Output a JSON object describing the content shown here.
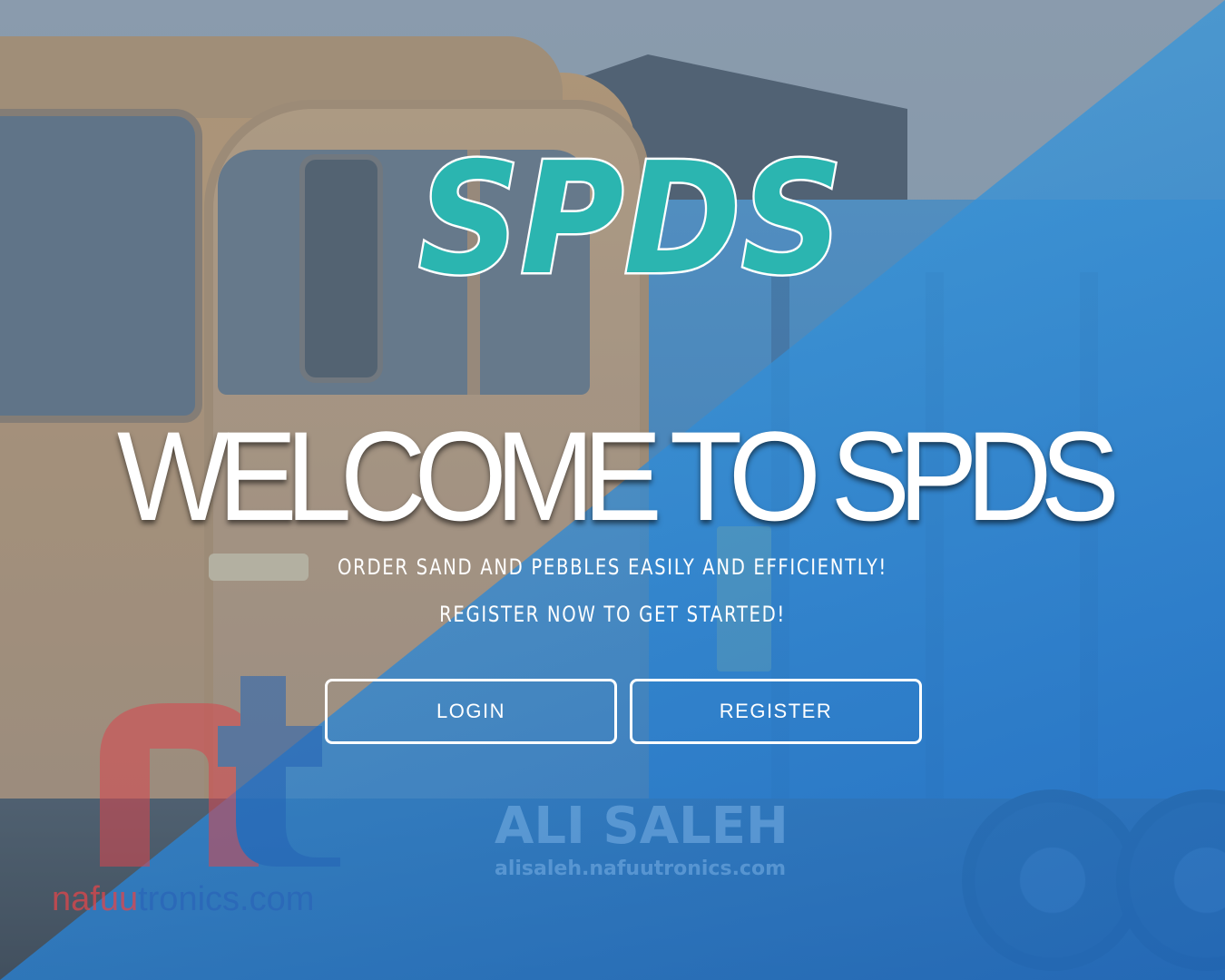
{
  "logo": {
    "text": "SPDS"
  },
  "hero": {
    "headline": "WELCOME TO SPDS",
    "tagline_1": "ORDER SAND AND PEBBLES EASILY AND EFFICIENTLY!",
    "tagline_2": "REGISTER NOW TO GET STARTED!"
  },
  "actions": {
    "login_label": "LOGIN",
    "register_label": "REGISTER"
  },
  "watermarks": {
    "brand_mark": "nt",
    "brand_domain_part1": "nafuu",
    "brand_domain_part2": "tronics.com",
    "author_name": "ALI SALEH",
    "author_url": "alisaleh.nafuutronics.com"
  },
  "colors": {
    "logo_fill": "#2bb5b0",
    "overlay_blue": "#2a7fd0",
    "text": "#ffffff",
    "watermark_red": "#e0464a",
    "watermark_blue": "#2a65b8"
  }
}
